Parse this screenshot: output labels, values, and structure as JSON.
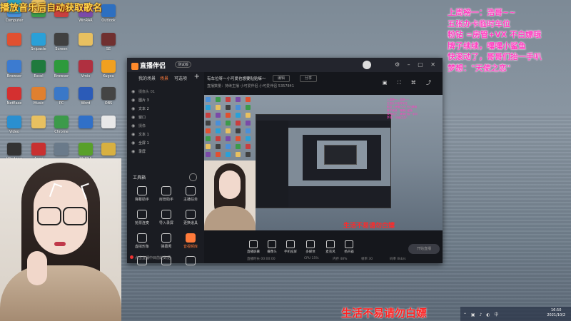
{
  "marquee": "播放音乐后自动获取歌名",
  "overlay_lines": [
    "上周榜一：浩哥~~",
    "五张办卡临时车位",
    "粉钻 =房管+VX   不白嫖哦",
    "牌子续续，嘿嘿小鲨鱼",
    "快滚动了，哥哥们抬一手叭",
    "梦想：\"天使之恋\""
  ],
  "desktop_icons": [
    {
      "label": "Computer",
      "color": "#4a8fd8"
    },
    {
      "label": "",
      "color": "#3c9a4a"
    },
    {
      "label": "",
      "color": "#c83f3f"
    },
    {
      "label": "WinRAR",
      "color": "#7a4aa8"
    },
    {
      "label": "Outlook",
      "color": "#2d6fc0"
    },
    {
      "label": "",
      "color": "#e05030"
    },
    {
      "label": "Snipaste",
      "color": "#2aa0d8"
    },
    {
      "label": "Screen",
      "color": "#404040"
    },
    {
      "label": "",
      "color": "#e8c060"
    },
    {
      "label": "SE",
      "color": "#703030"
    },
    {
      "label": "Browser",
      "color": "#3c7bd0"
    },
    {
      "label": "Excel",
      "color": "#1f7a3e"
    },
    {
      "label": "Browser",
      "color": "#2d9a3c"
    },
    {
      "label": "Vmix",
      "color": "#b03040"
    },
    {
      "label": "Kugou",
      "color": "#f0a020"
    },
    {
      "label": "NetEase",
      "color": "#d43030"
    },
    {
      "label": "Music",
      "color": "#e08030"
    },
    {
      "label": "PC",
      "color": "#3a78c8"
    },
    {
      "label": "Word",
      "color": "#2b5bb8"
    },
    {
      "label": "OBS",
      "color": "#444"
    },
    {
      "label": "Video",
      "color": "#2a8fd0"
    },
    {
      "label": "",
      "color": "#e8c060"
    },
    {
      "label": "Chrome",
      "color": "#3c9a4a"
    },
    {
      "label": "",
      "color": "#3070c8"
    },
    {
      "label": "",
      "color": "#e8e8e8"
    },
    {
      "label": "Windows",
      "color": "#333"
    },
    {
      "label": "Apex",
      "color": "#c83030"
    },
    {
      "label": "",
      "color": "#6a7a8a"
    },
    {
      "label": "NVIDIA",
      "color": "#58a02a"
    },
    {
      "label": "",
      "color": "#d8b040"
    },
    {
      "label": "",
      "color": "#2aa0c0"
    },
    {
      "label": "",
      "color": "#e8c060"
    }
  ],
  "app": {
    "logo": "直播伴侣",
    "version": "测试版",
    "window_buttons": "⚙ – ▢ ✕",
    "tabs": [
      "我的场景",
      "场景",
      "可选项"
    ],
    "active_tab": 1,
    "sources": [
      {
        "name": "摄像头 01",
        "group": true
      },
      {
        "name": "图片 3",
        "group": false
      },
      {
        "name": "文本 2",
        "group": false
      },
      {
        "name": "窗口",
        "group": false
      },
      {
        "name": "摄像",
        "group": true
      },
      {
        "name": "文本 1",
        "group": false
      },
      {
        "name": "全屏 1",
        "group": false
      },
      {
        "name": "录屏",
        "group": false
      }
    ],
    "tools_heading": "工具箱",
    "tools": [
      {
        "label": "弹幕助手",
        "hot": false
      },
      {
        "label": "房管助手",
        "hot": false
      },
      {
        "label": "主播任务",
        "hot": false
      },
      {
        "label": "抢票连麦",
        "hot": false
      },
      {
        "label": "导入录屏",
        "hot": false
      },
      {
        "label": "更换道具",
        "hot": false
      },
      {
        "label": "虚拟形象",
        "hot": false
      },
      {
        "label": "弹幕秀",
        "hot": false
      },
      {
        "label": "音视频库",
        "hot": true
      },
      {
        "label": "",
        "hot": false
      },
      {
        "label": "",
        "hot": false
      },
      {
        "label": "",
        "hot": false
      }
    ],
    "sidebar_footer": "点击直播中目前的数据",
    "room_title": "有车位呀～小可爱也想要贴贴嘛～",
    "btn_edit": "编辑",
    "btn_share": "分享",
    "room_sub": "直播数量：持续主播    小可爱伴侣 小可爱伴侣  5357841",
    "preview_overlay": [
      "上周榜一：浩哥~~",
      "五张办卡临时车位",
      "粉钻 =房管+VX 不白嫖哦",
      "牌子续续，嘿嘿小鲨鱼",
      "快滚动了，哥哥们抬一手叭",
      "梦想：\"天使之恋\""
    ],
    "preview_banner": "生活不易请勿白嫖",
    "controls": [
      "直播屏幕",
      "摄像头",
      "手机投屏",
      "多媒体",
      "麦克风",
      "扬声器"
    ],
    "start_button": "开始直播",
    "status": [
      "直播时长 00:00:00",
      "CPU 15%",
      "内存 48%",
      "帧率 30",
      "码率 0kb/s"
    ]
  },
  "banner": "生活不易请勿白嫖",
  "clock": {
    "time": "16:50",
    "date": "2021/10/2"
  },
  "tray_icons": "⌃ ▣ ♪ ◐ 中"
}
